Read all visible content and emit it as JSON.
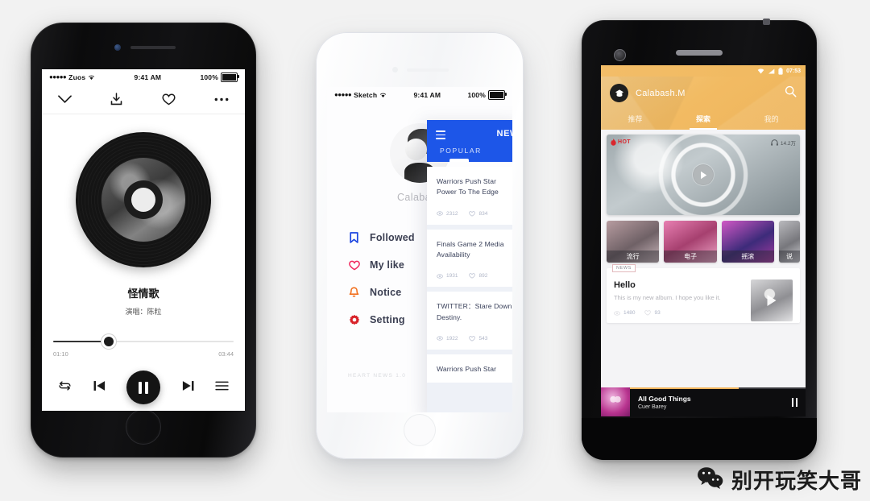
{
  "canvas": {
    "background": "#f2f2f2"
  },
  "phone_left": {
    "device": "black-iphone",
    "status": {
      "dots": "●●●●●",
      "carrier": "Zuos",
      "wifi": "wifi-icon",
      "time": "9:41 AM",
      "battery": "100%"
    },
    "topbar": {
      "collapse": "chevron-down-icon",
      "download": "download-icon",
      "like": "heart-icon",
      "more": "more-icon"
    },
    "now_playing": {
      "title": "怪情歌",
      "artist": "演唱：陈粒",
      "elapsed": "01:10",
      "duration": "03:44",
      "progress_percent": 31
    },
    "controls": {
      "repeat": "repeat-icon",
      "previous": "previous-icon",
      "play_pause": "pause-icon",
      "next": "next-icon",
      "playlist": "playlist-icon"
    }
  },
  "phone_center": {
    "device": "white-iphone",
    "status": {
      "dots": "●●●●●",
      "carrier": "Sketch",
      "wifi": "wifi-icon",
      "time": "9:41 AM",
      "battery": "100%"
    },
    "drawer": {
      "avatar": "user-avatar",
      "username": "Calabash",
      "items": [
        {
          "label": "Followed",
          "icon": "bookmark-icon",
          "color": "#1d46e0"
        },
        {
          "label": "My like",
          "icon": "heart-icon",
          "color": "#f0295e"
        },
        {
          "label": "Notice",
          "icon": "bell-icon",
          "color": "#f2701e"
        },
        {
          "label": "Setting",
          "icon": "gear-icon",
          "color": "#d8232a"
        }
      ],
      "footer": "HEART NEWS 1.0"
    },
    "panel": {
      "accent": "#1d56e8",
      "menu_icon": "hamburger-icon",
      "tab_new": "NEW",
      "tab_popular": "POPULAR",
      "cards": [
        {
          "title": "Warriors Push Star Power To The Edge",
          "views": "2312",
          "likes": "834"
        },
        {
          "title": "Finals Game 2 Media Availability",
          "views": "1931",
          "likes": "892"
        },
        {
          "title": "TWITTER：Stare Down Destiny.",
          "views": "1922",
          "likes": "543"
        },
        {
          "title": "Warriors Push Star",
          "views": "",
          "likes": ""
        }
      ]
    }
  },
  "phone_right": {
    "device": "android",
    "accent": "#f0b45c",
    "status": {
      "wifi": "wifi-icon",
      "signal": "signal-icon",
      "battery": "battery-icon",
      "time": "07:53"
    },
    "header": {
      "logo": "app-logo-icon",
      "brand": "Calabash.M",
      "search": "search-icon"
    },
    "tabs": [
      {
        "label": "推荐",
        "active": false
      },
      {
        "label": "探索",
        "active": true
      },
      {
        "label": "我的",
        "active": false
      }
    ],
    "banner": {
      "badge": "HOT",
      "flame": "flame-icon",
      "plays_icon": "headphone-icon",
      "plays": "14.2万",
      "play": "play-icon"
    },
    "categories": [
      {
        "label": "流行"
      },
      {
        "label": "电子"
      },
      {
        "label": "摇滚"
      },
      {
        "label": "说"
      }
    ],
    "news": {
      "tag": "NEWS",
      "title": "Hello",
      "desc": "This is my new album. I hope you like it.",
      "views": "1480",
      "likes": "93",
      "thumb_play": "play-icon"
    },
    "mini_player": {
      "title": "All Good Things",
      "artist": "Cuer Barey",
      "pause": "pause-icon"
    }
  },
  "watermark": {
    "icon": "wechat-icon",
    "text": "别开玩笑大哥"
  }
}
